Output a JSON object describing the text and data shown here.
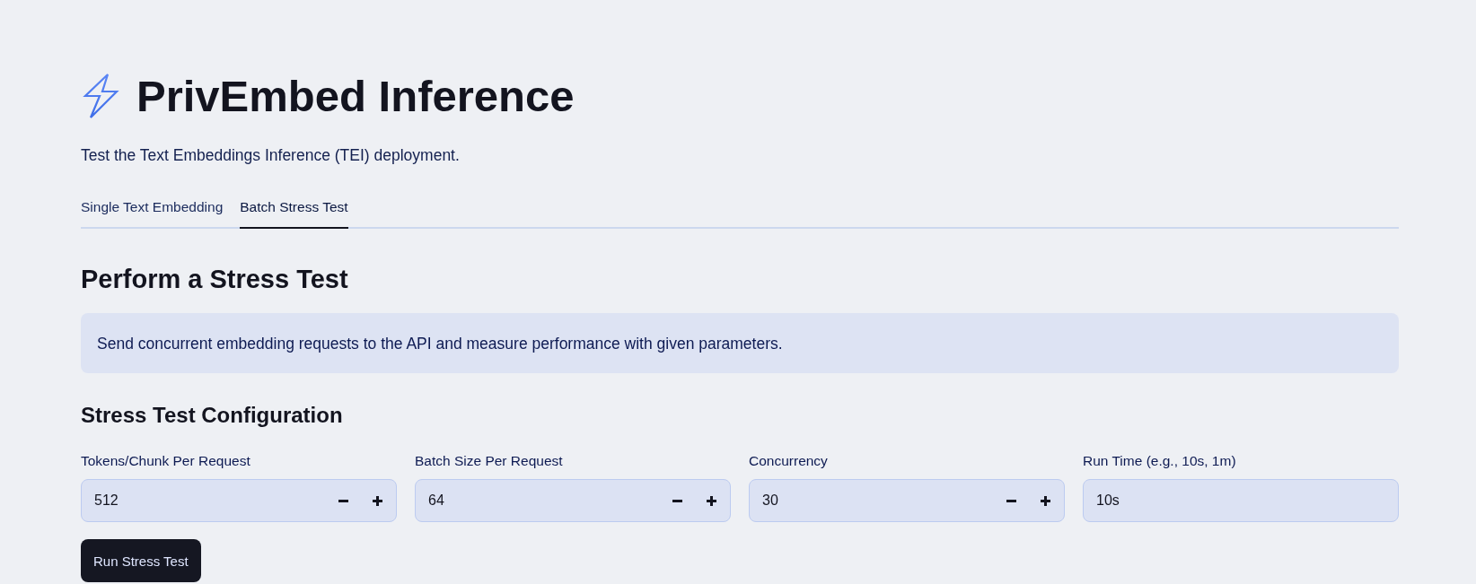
{
  "header": {
    "title": "PrivEmbed Inference",
    "subtitle": "Test the Text Embeddings Inference (TEI) deployment."
  },
  "tabs": [
    {
      "label": "Single Text Embedding",
      "selected": false
    },
    {
      "label": "Batch Stress Test",
      "selected": true
    }
  ],
  "section": {
    "heading": "Perform a Stress Test",
    "info": "Send concurrent embedding requests to the API and measure performance with given parameters."
  },
  "config": {
    "heading": "Stress Test Configuration",
    "fields": [
      {
        "kind": "number",
        "label": "Tokens/Chunk Per Request",
        "value": "512"
      },
      {
        "kind": "number",
        "label": "Batch Size Per Request",
        "value": "64"
      },
      {
        "kind": "number",
        "label": "Concurrency",
        "value": "30"
      },
      {
        "kind": "text",
        "label": "Run Time (e.g., 10s, 1m)",
        "value": "10s"
      }
    ]
  },
  "run_button": {
    "label": "Run Stress Test"
  }
}
